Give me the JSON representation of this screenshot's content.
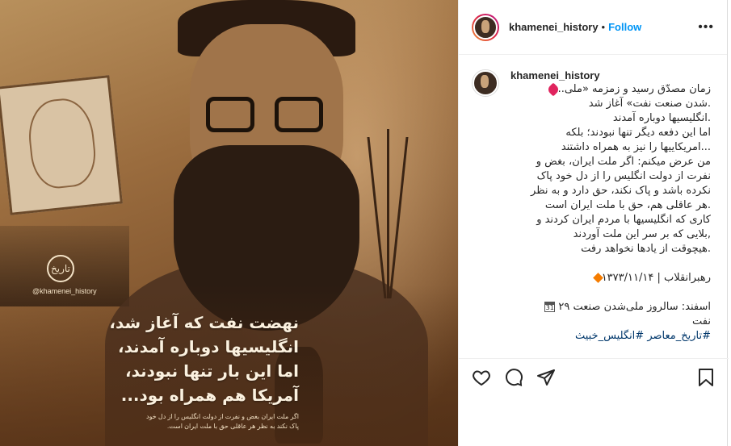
{
  "post": {
    "username": "khamenei_history",
    "follow_label": "Follow",
    "more_label": "•••",
    "separator": "•"
  },
  "image": {
    "watermark_handle": "@khamenei_history",
    "watermark_seal": "تاریخ",
    "overlay_lines": [
      "نهضت نفت که آغاز شد،",
      "انگلیسیها دوباره آمدند،",
      "اما این بار تنها نبودند،",
      "آمریکا هم همراه بود..."
    ],
    "overlay_small_lines": [
      "اگر ملت ایران بغض و نفرت از دولت انگلیس را از دل خود",
      "پاک نکند به نظر هر عاقلی حق با ملت ایران است."
    ]
  },
  "caption": {
    "username": "khamenei_history",
    "lines": [
      "زمان مصدّق رسید و زمزمه «ملی..",
      ".شدن صنعت نفت» آغاز شد",
      ".انگلیسیها دوباره آمدند",
      "اما این دفعه دیگر تنها نبودند؛ بلکه",
      "...امریکاییها را نیز به همراه داشتند",
      "من عرض میکنم: اگر ملت ایران، بغض و",
      "نفرت از دولت انگلیس را از دل خود پاک",
      "نکرده باشد و پاک نکند، حق دارد و به نظر",
      ".هر عاقلی هم، حق با ملت ایران است",
      "کاری که انگلیسیها با مردم ایران کردند و",
      ",بلایی که بر سر این ملت آوردند",
      ".هیچوقت از یادها نخواهد رفت"
    ],
    "source": "رهبرانقلاب | ۱۳۷۳/۱۱/۱۴",
    "date_line": "اسفند: سالروز ملی‌شدن صنعت ۲۹",
    "date_line_2": "نفت",
    "calendar_glyph": "31",
    "hashtags": "#تاریخ_معاصر #انگلیس_خبیث"
  },
  "icons": {
    "pin": "pushpin-icon",
    "diamond": "orange-diamond-icon",
    "calendar": "calendar-icon",
    "like": "heart-icon",
    "comment": "comment-icon",
    "share": "share-icon",
    "save": "bookmark-icon"
  },
  "colors": {
    "follow": "#0095f6",
    "hashtag": "#00376b",
    "text": "#262626"
  }
}
